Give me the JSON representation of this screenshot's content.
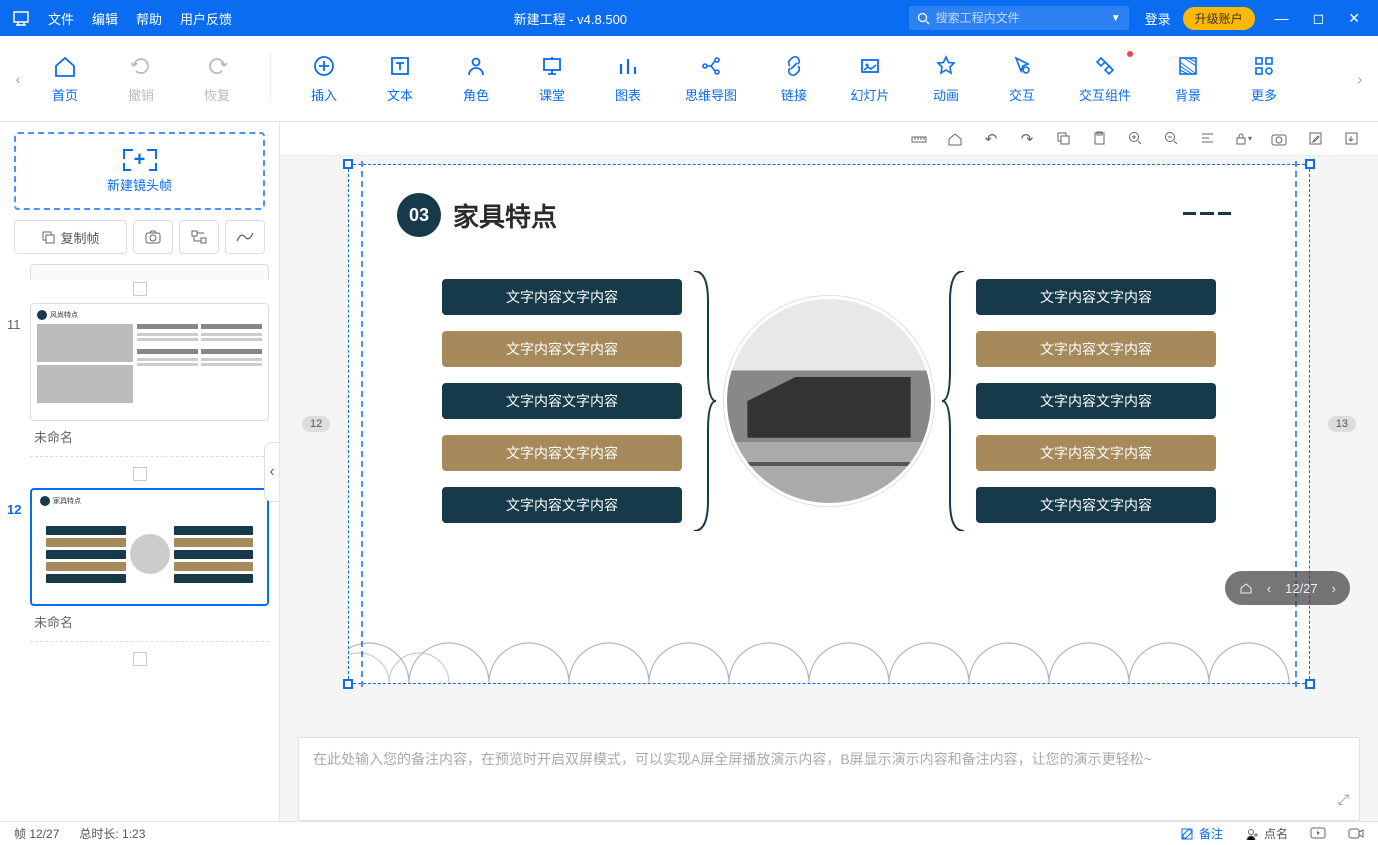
{
  "titlebar": {
    "menus": [
      "文件",
      "编辑",
      "帮助",
      "用户反馈"
    ],
    "title": "新建工程 - v4.8.500",
    "search_placeholder": "搜索工程内文件",
    "login": "登录",
    "upgrade": "升级账户"
  },
  "ribbon": {
    "tools": [
      {
        "label": "首页",
        "icon": "home"
      },
      {
        "label": "撤销",
        "icon": "undo",
        "disabled": true
      },
      {
        "label": "恢复",
        "icon": "redo",
        "disabled": true
      },
      {
        "label": "插入",
        "icon": "plus-circle"
      },
      {
        "label": "文本",
        "icon": "text"
      },
      {
        "label": "角色",
        "icon": "person"
      },
      {
        "label": "课堂",
        "icon": "board"
      },
      {
        "label": "图表",
        "icon": "chart"
      },
      {
        "label": "思维导图",
        "icon": "mindmap",
        "wide": true
      },
      {
        "label": "链接",
        "icon": "link"
      },
      {
        "label": "幻灯片",
        "icon": "slides"
      },
      {
        "label": "动画",
        "icon": "star"
      },
      {
        "label": "交互",
        "icon": "pointer"
      },
      {
        "label": "交互组件",
        "icon": "widget",
        "wide": true,
        "dot": true
      },
      {
        "label": "背景",
        "icon": "bg"
      },
      {
        "label": "更多",
        "icon": "more"
      }
    ]
  },
  "sidebar": {
    "new_frame": "新建镜头帧",
    "copy_frame": "复制帧",
    "thumbs": [
      {
        "num": "11",
        "label": "未命名"
      },
      {
        "num": "12",
        "label": "未命名",
        "active": true
      }
    ]
  },
  "slide": {
    "badge": "03",
    "title": "家具特点",
    "pill_text": "文字内容文字内容",
    "left_badge": "12",
    "right_badge": "13"
  },
  "notes": {
    "placeholder": "在此处输入您的备注内容，在预览时开启双屏模式，可以实现A屏全屏播放演示内容，B屏显示演示内容和备注内容，让您的演示更轻松~"
  },
  "floatnav": {
    "counter": "12/27"
  },
  "statusbar": {
    "frame": "帧 12/27",
    "duration": "总时长: 1:23",
    "notes": "备注",
    "roll": "点名"
  }
}
